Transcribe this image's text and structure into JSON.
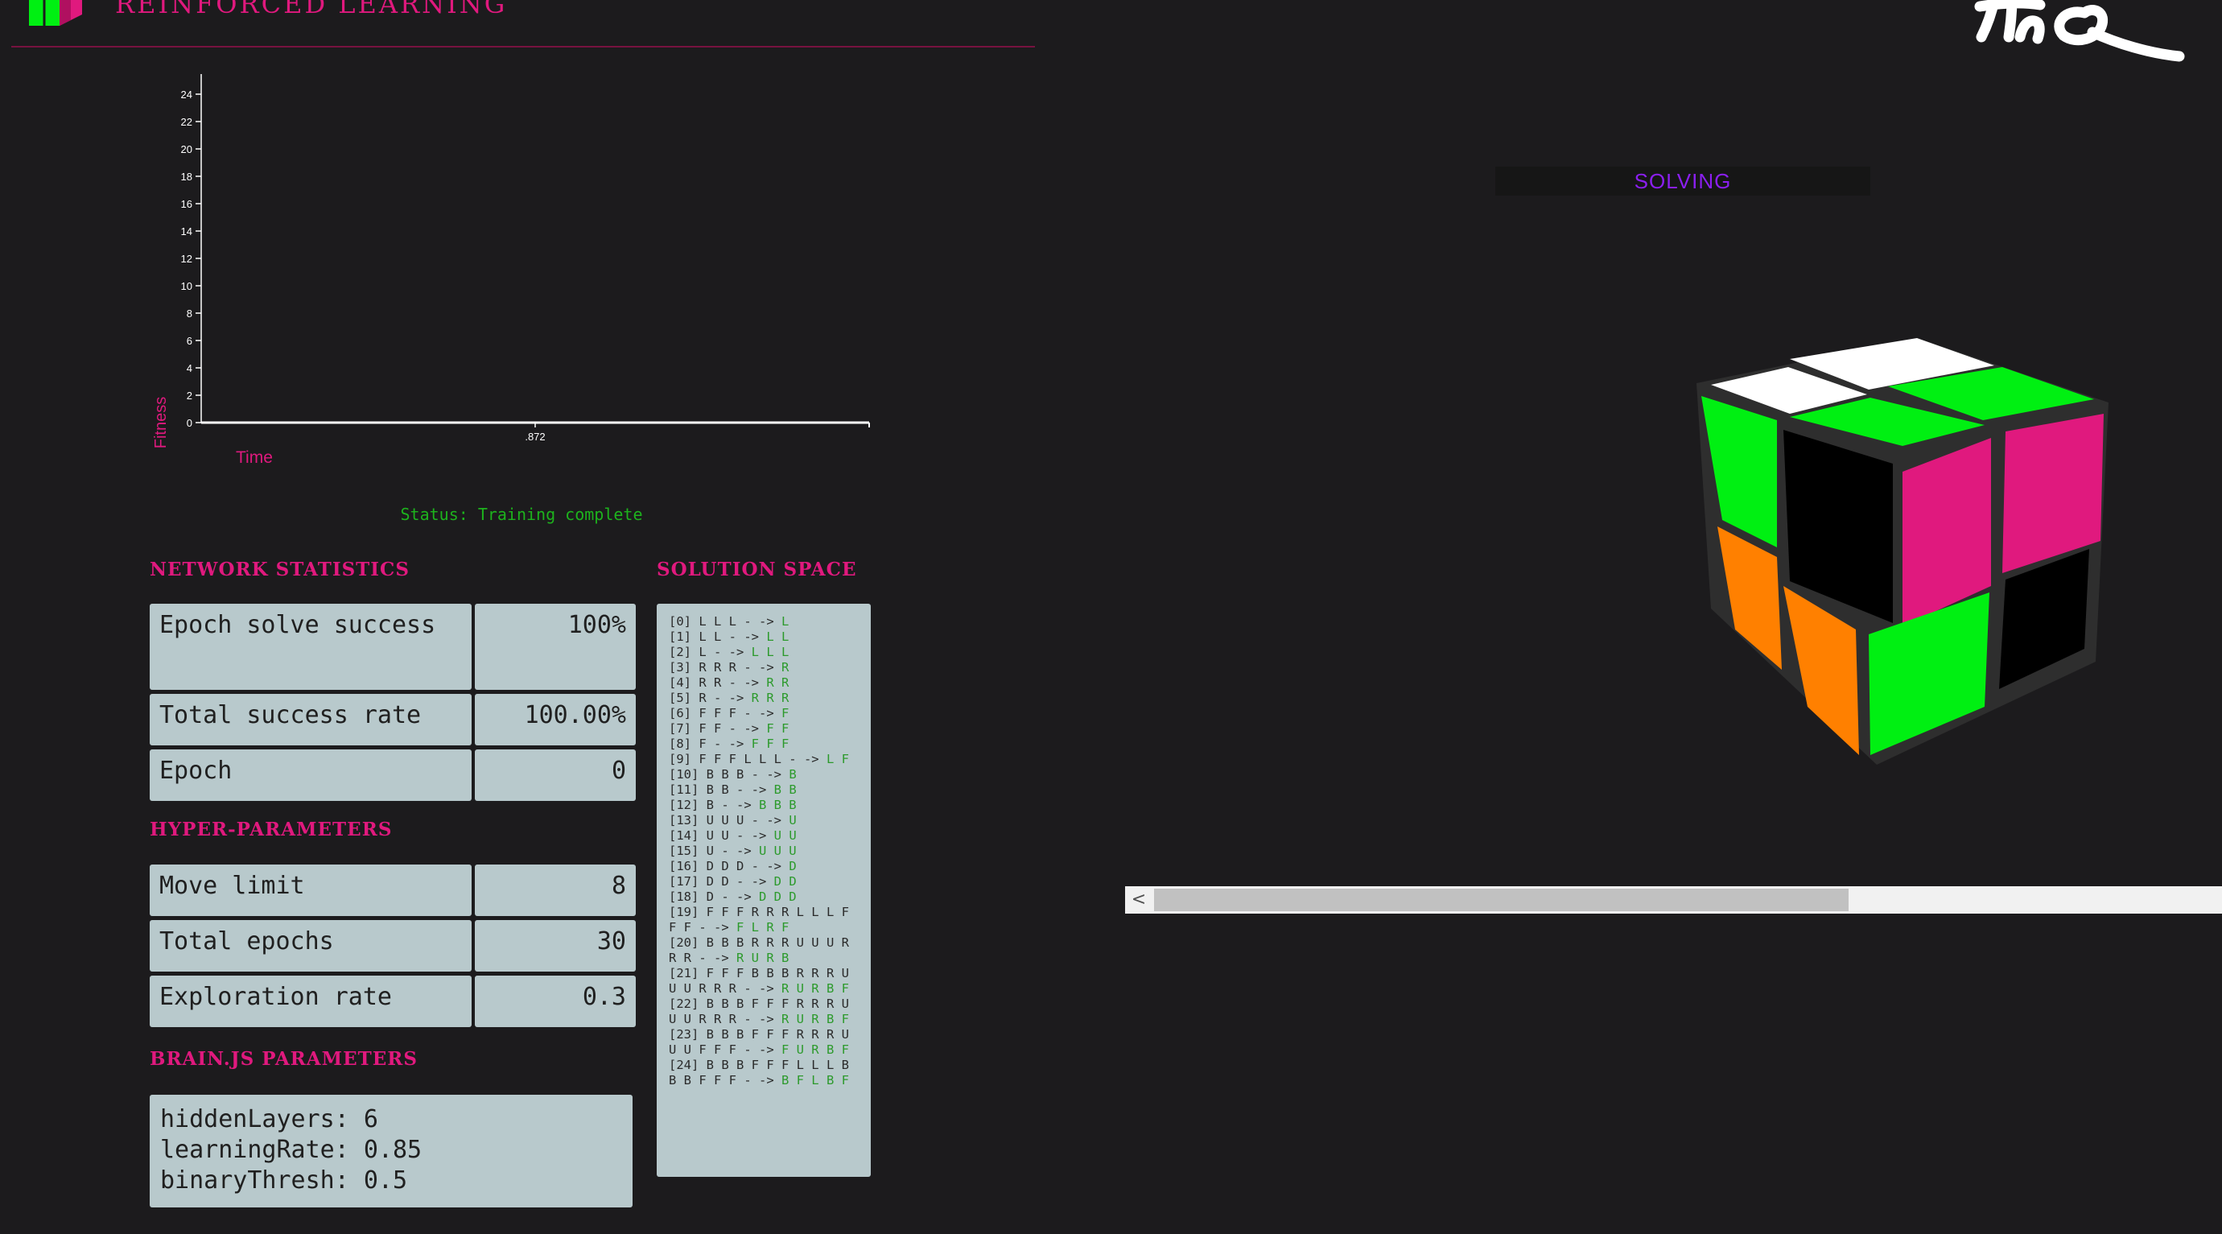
{
  "header": {
    "title": "REINFORCED LEARNING"
  },
  "chart_data": {
    "type": "line",
    "ylabel": "Fitness",
    "xlabel": "Time",
    "ylim": [
      0,
      25
    ],
    "yticks": [
      "0",
      "2",
      "4",
      "6",
      "8",
      "10",
      "12",
      "14",
      "16",
      "18",
      "20",
      "22",
      "24"
    ],
    "xticks": [
      ".872"
    ],
    "series": []
  },
  "status": {
    "text": "Status: Training complete"
  },
  "network_statistics": {
    "title": "NETWORK STATISTICS",
    "rows": [
      {
        "label": "Epoch solve success",
        "value": "100%"
      },
      {
        "label": "Total success rate",
        "value": "100.00%"
      },
      {
        "label": "Epoch",
        "value": "0"
      }
    ]
  },
  "hyper_parameters": {
    "title": "HYPER-PARAMETERS",
    "rows": [
      {
        "label": "Move limit",
        "value": "8"
      },
      {
        "label": "Total epochs",
        "value": "30"
      },
      {
        "label": "Exploration rate",
        "value": "0.3"
      }
    ]
  },
  "brainjs_parameters": {
    "title": "BRAIN.JS PARAMETERS",
    "lines": [
      "hiddenLayers: 6",
      "learningRate: 0.85",
      "binaryThresh: 0.5"
    ]
  },
  "solution_space": {
    "title": "SOLUTION SPACE",
    "entries": [
      {
        "scramble": "[0] L L L - -> ",
        "solution": "L"
      },
      {
        "scramble": "[1] L L - -> ",
        "solution": "L L"
      },
      {
        "scramble": "[2] L - -> ",
        "solution": "L L L"
      },
      {
        "scramble": "[3] R R R - -> ",
        "solution": "R"
      },
      {
        "scramble": "[4] R R - -> ",
        "solution": "R R"
      },
      {
        "scramble": "[5] R - -> ",
        "solution": "R R R"
      },
      {
        "scramble": "[6] F F F - -> ",
        "solution": "F"
      },
      {
        "scramble": "[7] F F - -> ",
        "solution": "F F"
      },
      {
        "scramble": "[8] F - -> ",
        "solution": "F F F"
      },
      {
        "scramble": "[9] F F F L L L - -> ",
        "solution": "L F"
      },
      {
        "scramble": "[10] B B B - -> ",
        "solution": "B"
      },
      {
        "scramble": "[11] B B - -> ",
        "solution": "B B"
      },
      {
        "scramble": "[12] B - -> ",
        "solution": "B B B"
      },
      {
        "scramble": "[13] U U U - -> ",
        "solution": "U"
      },
      {
        "scramble": "[14] U U - -> ",
        "solution": "U U"
      },
      {
        "scramble": "[15] U - -> ",
        "solution": "U U U"
      },
      {
        "scramble": "[16] D D D - -> ",
        "solution": "D"
      },
      {
        "scramble": "[17] D D - -> ",
        "solution": "D D"
      },
      {
        "scramble": "[18] D - -> ",
        "solution": "D D D"
      },
      {
        "scramble": "[19] F F F R R R L L L F F F - -> ",
        "solution": "F L R F"
      },
      {
        "scramble": "[20] B B B R R R U U U R R R - -> ",
        "solution": "R U R B"
      },
      {
        "scramble": "[21] F F F B B B R R R U U U R R R - -> ",
        "solution": "R U R B F"
      },
      {
        "scramble": "[22] B B B F F F R R R U U U R R R - -> ",
        "solution": "R U R B F"
      },
      {
        "scramble": "[23] B B B F F F R R R U U U F F F - -> ",
        "solution": "F U R B F"
      },
      {
        "scramble": "[24] B B B F F F L L L B B B F F F - -> ",
        "solution": "B F L B F"
      }
    ]
  },
  "solver": {
    "state_label": "SOLVING",
    "cube_colors": {
      "white": "#ffffff",
      "green": "#00f012",
      "magenta": "#e0197e",
      "orange": "#ff8000",
      "black": "#000000"
    }
  },
  "scrollbar": {
    "left_arrow": "<",
    "position": 0.65
  }
}
